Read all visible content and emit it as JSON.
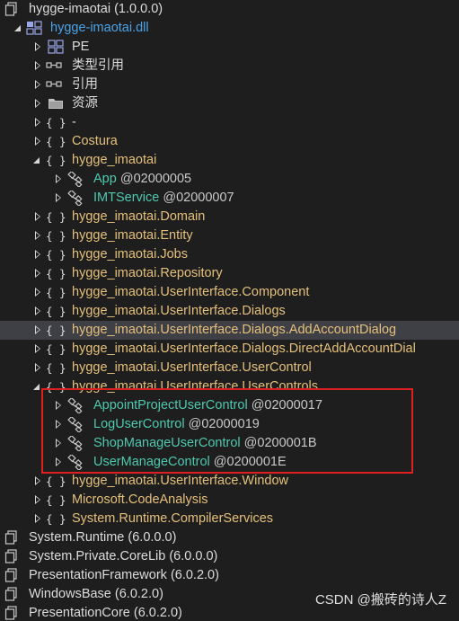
{
  "tree": {
    "root_assembly": "hygge-imaotai (1.0.0.0)",
    "module": "hygge-imaotai.dll",
    "items": {
      "pe": "PE",
      "types": "类型引用",
      "refs": "引用",
      "resources": "资源",
      "dash": "-",
      "costura": "Costura",
      "ns_root": "hygge_imaotai",
      "class_app": "App",
      "class_app_token": "@02000005",
      "class_imt": "IMTService",
      "class_imt_token": "@02000007",
      "ns_domain": "hygge_imaotai.Domain",
      "ns_entity": "hygge_imaotai.Entity",
      "ns_jobs": "hygge_imaotai.Jobs",
      "ns_repo": "hygge_imaotai.Repository",
      "ns_ui_component": "hygge_imaotai.UserInterface.Component",
      "ns_ui_dialogs": "hygge_imaotai.UserInterface.Dialogs",
      "ns_ui_dialogs_add": "hygge_imaotai.UserInterface.Dialogs.AddAccountDialog",
      "ns_ui_dialogs_direct": "hygge_imaotai.UserInterface.Dialogs.DirectAddAccountDial",
      "ns_ui_usercontrol": "hygge_imaotai.UserInterface.UserControl",
      "ns_ui_usercontrols": "hygge_imaotai.UserInterface.UserControls",
      "uc_appoint": "AppointProjectUserControl",
      "uc_appoint_token": "@02000017",
      "uc_log": "LogUserControl",
      "uc_log_token": "@02000019",
      "uc_shop": "ShopManageUserControl",
      "uc_shop_token": "@0200001B",
      "uc_user": "UserManageControl",
      "uc_user_token": "@0200001E",
      "ns_ui_window": "hygge_imaotai.UserInterface.Window",
      "ns_ms_code": "Microsoft.CodeAnalysis",
      "ns_sys_runtime_cs": "System.Runtime.CompilerServices",
      "asm_sys_runtime": "System.Runtime (6.0.0.0)",
      "asm_sys_private": "System.Private.CoreLib (6.0.0.0)",
      "asm_presentation_fw": "PresentationFramework (6.0.2.0)",
      "asm_windowsbase": "WindowsBase (6.0.2.0)",
      "asm_presentation_core": "PresentationCore (6.0.2.0)"
    },
    "icons": {
      "namespace": "{ }",
      "class": "class-icon",
      "assembly": "assembly-icon",
      "module": "module-icon",
      "reference": "reference-icon",
      "folder": "folder-icon"
    }
  },
  "watermark": "CSDN @搬砖的诗人Z",
  "colors": {
    "background": "#1e1e1e",
    "namespace": "#e5c07b",
    "class": "#4ec9b0",
    "module": "#4aa3e8",
    "selected_row": "#3f3f46",
    "highlight_box": "#e02020"
  }
}
